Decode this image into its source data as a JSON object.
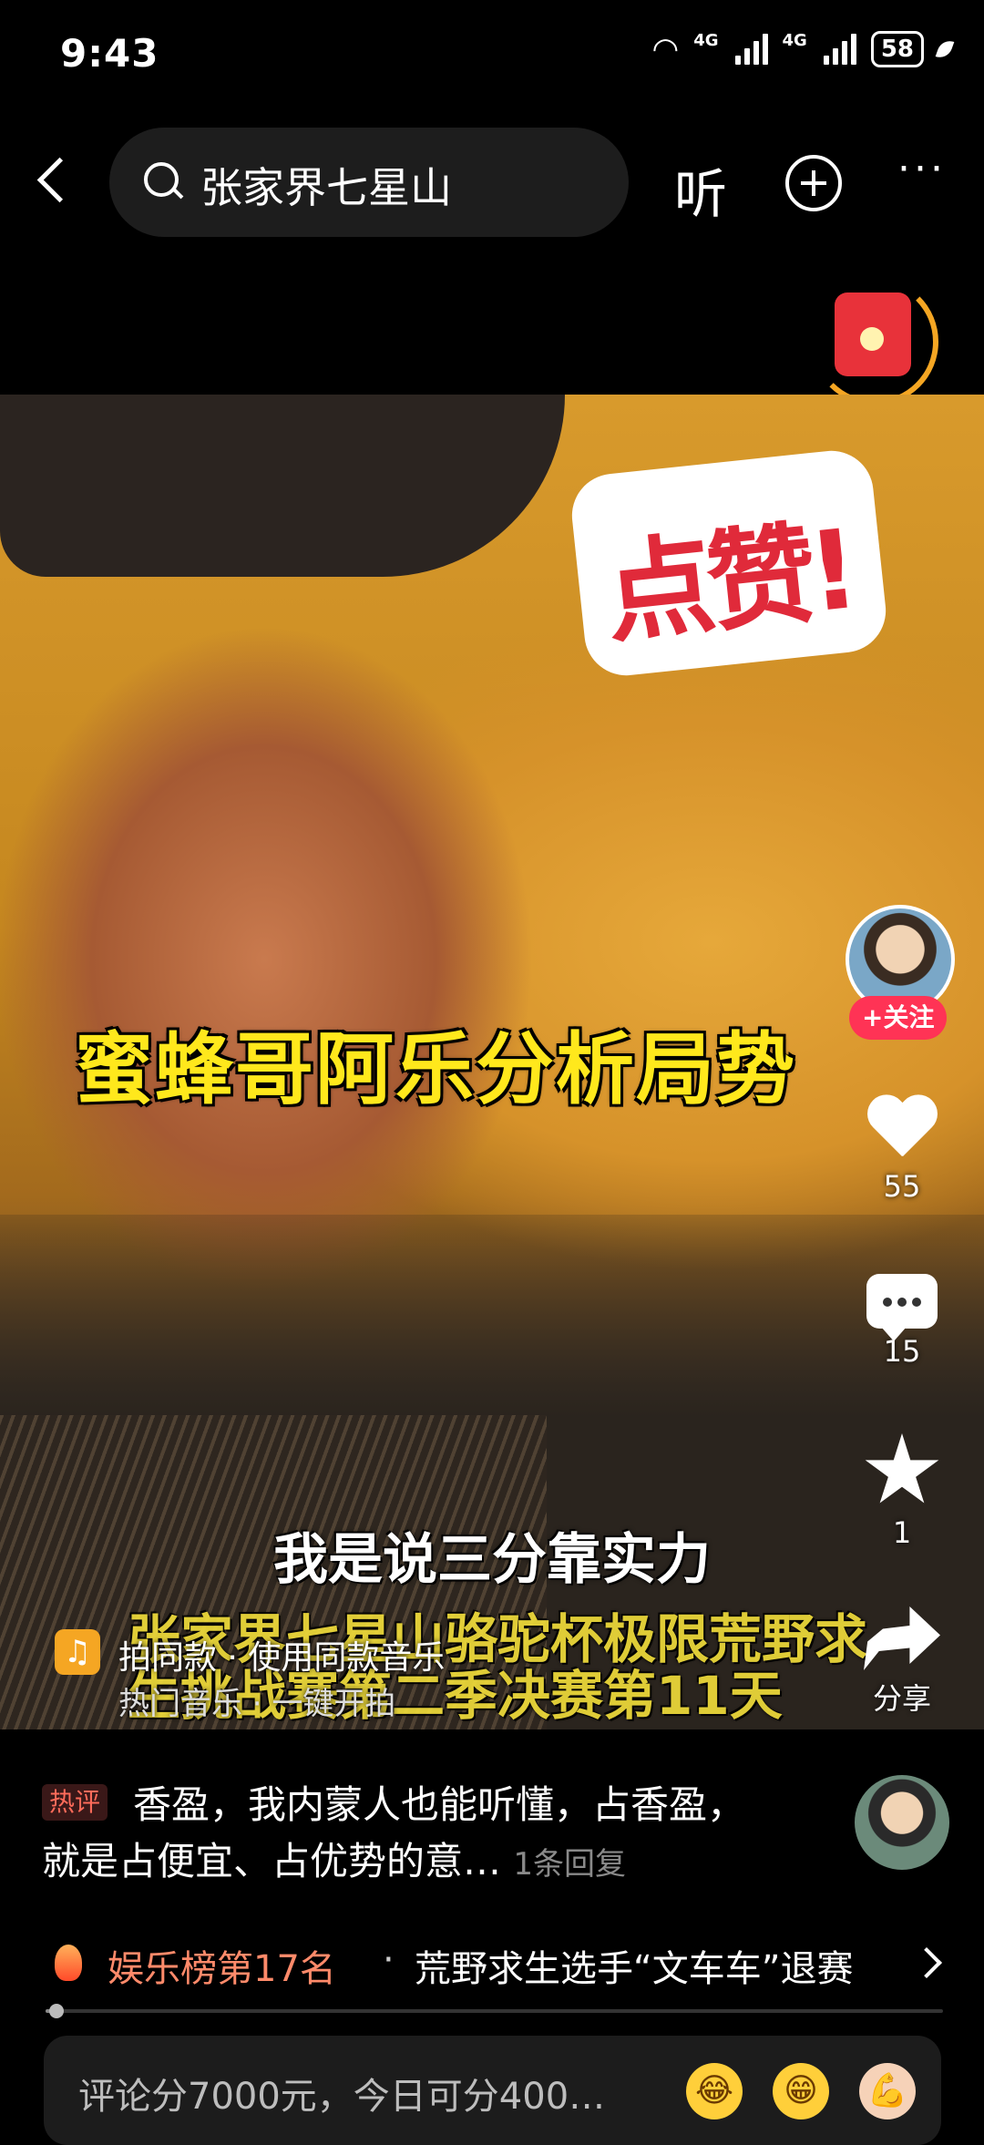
{
  "status_bar": {
    "time": "9:43",
    "network_1": "4G",
    "network_2": "4G",
    "battery": "58"
  },
  "top_bar": {
    "search_query": "张家界七星山",
    "listen_label": "听",
    "more_label": "···"
  },
  "video": {
    "sticker_text": "点赞!",
    "caption_main": "蜜蜂哥阿乐分析局势",
    "subtitle": "我是说三分靠实力",
    "big_title": "张家界七星山骆驼杯极限荒野求生挑战赛第二季决赛第11天",
    "music": {
      "line1": "拍同款 · 使用同款音乐",
      "line2": "热门音乐 · 一键开拍"
    }
  },
  "rail": {
    "follow_label": "+关注",
    "likes": "55",
    "comments": "15",
    "favorites": "1",
    "share_label": "分享"
  },
  "hot_comment": {
    "tag": "热评",
    "text": "香盈，我内蒙人也能听懂，占香盈，就是占便宜、占优势的意…",
    "reply": "1条回复"
  },
  "ranking": {
    "rank_label": "娱乐榜第17名",
    "separator": "·",
    "headline": "荒野求生选手“文车车”退赛"
  },
  "progress": {
    "value": 0.01
  },
  "comment_bar": {
    "placeholder": "评论分7000元，今日可分400…",
    "emoji_icons": [
      "laughing-tears-icon",
      "grinning-icon",
      "flexed-arm-icon"
    ]
  },
  "colors": {
    "accent_red": "#ff3355",
    "caption_yellow": "#ffe81c",
    "rank_orange": "#ff8a6a"
  }
}
